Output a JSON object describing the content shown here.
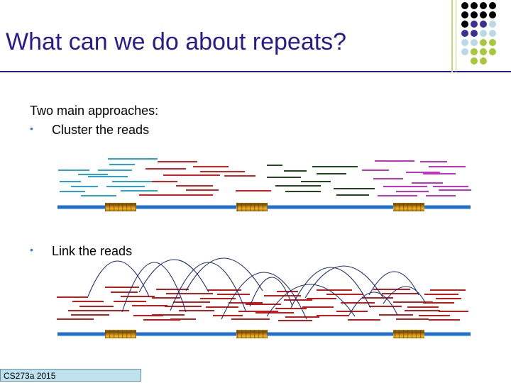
{
  "slide": {
    "title": "What can we do about repeats?",
    "intro": "Two main approaches:",
    "bullets": [
      {
        "marker": "•",
        "text": "Cluster the reads"
      },
      {
        "marker": "•",
        "text": "Link the reads"
      }
    ],
    "footer": "CS273a 2015"
  },
  "colors": {
    "title": "#2a1a8f",
    "bullet_marker": "#3a7cc7",
    "genome_line": "#1f6fce",
    "repeat_block": "#c9860e",
    "cluster_cyan": "#2aa3cf",
    "cluster_red": "#d81e1e",
    "cluster_green": "#1f4a1a",
    "cluster_magenta": "#c531c5",
    "link_reads": "#c41a1a",
    "link_arcs": "#1c2d6b",
    "decor_black": "#000000",
    "decor_purple": "#3b3194",
    "decor_lightblue": "#b8dae6",
    "decor_green": "#a6c93a"
  }
}
